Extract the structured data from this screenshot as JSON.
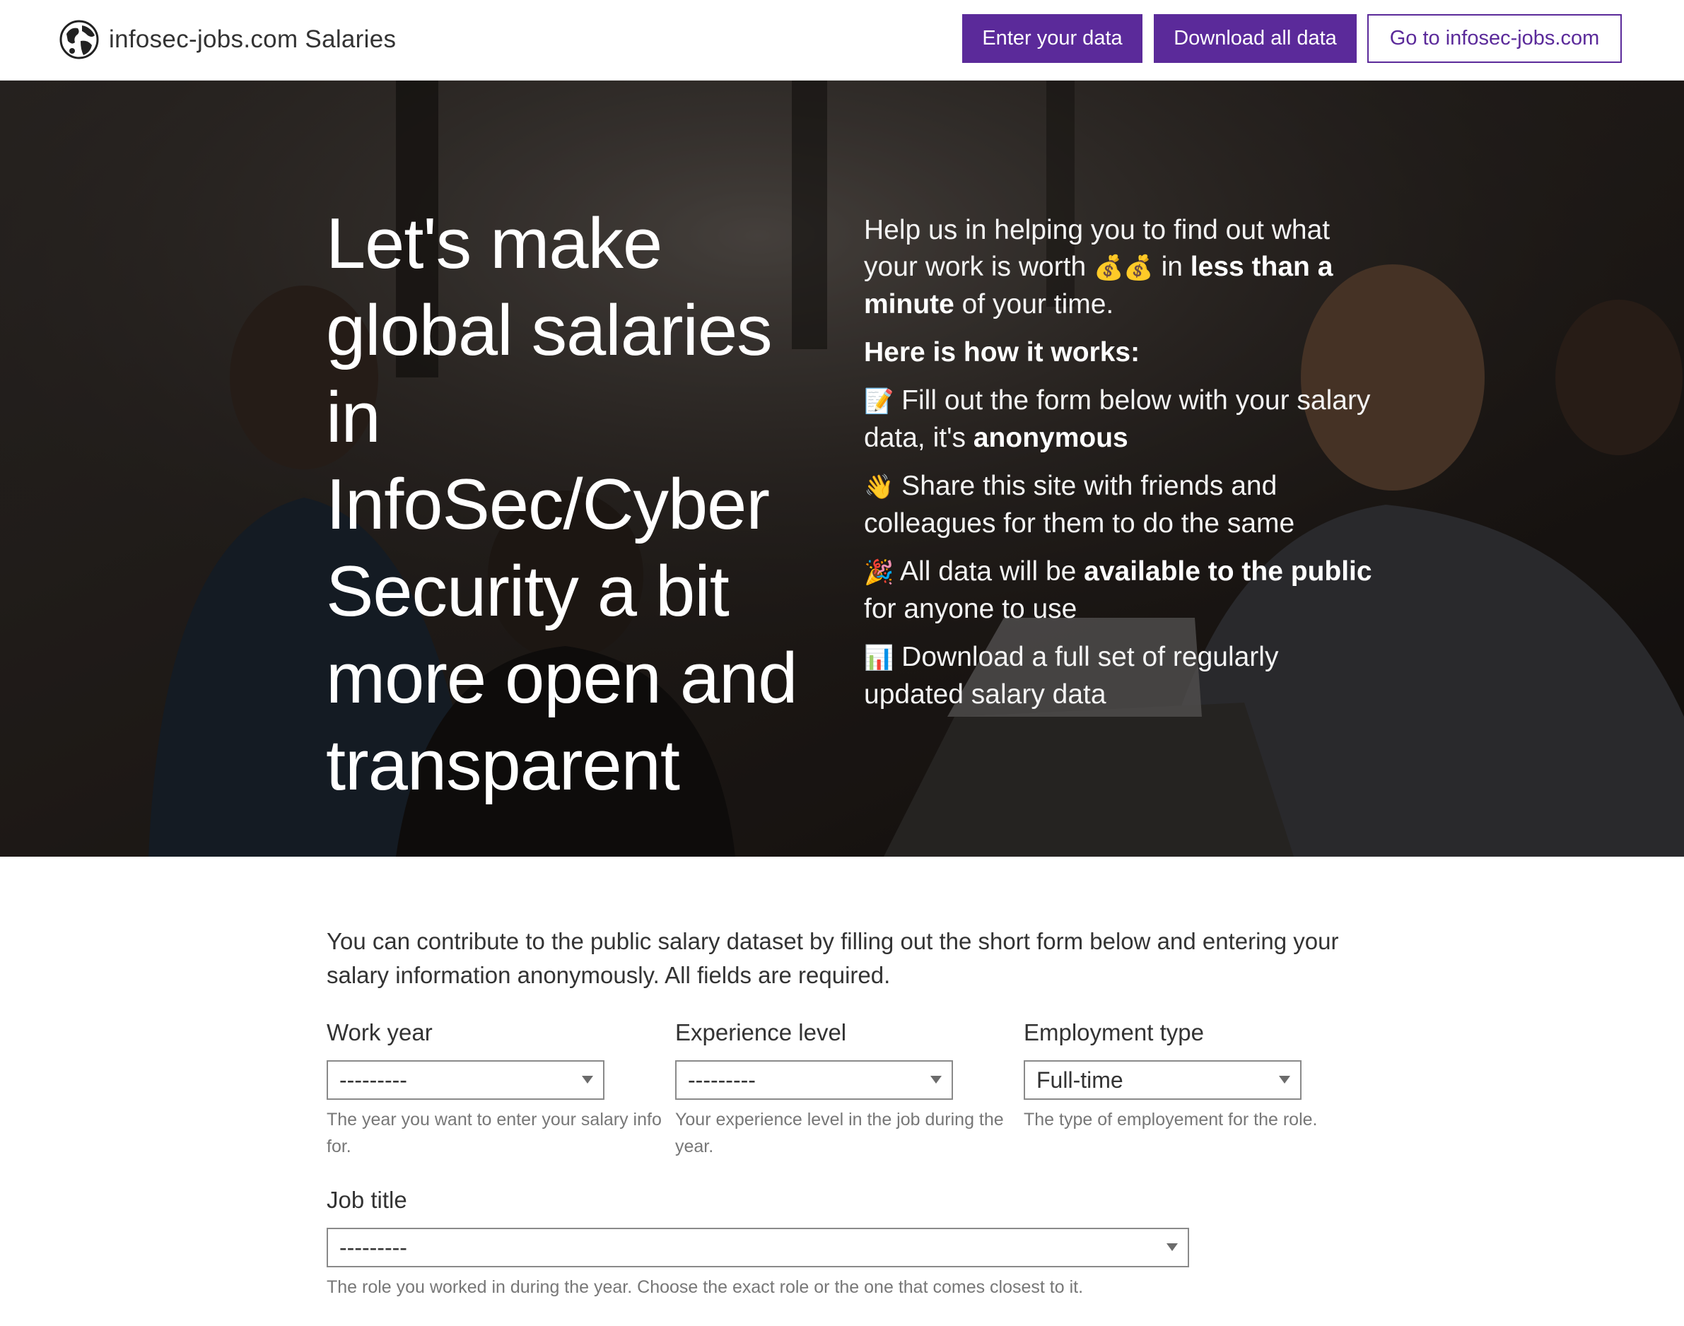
{
  "navbar": {
    "brand_text": "infosec-jobs.com Salaries",
    "logo_icon": "globe-icon",
    "buttons": {
      "enter": "Enter your data",
      "download": "Download all data",
      "goto": "Go to infosec-jobs.com"
    },
    "accent_color": "#5b2a9a"
  },
  "hero": {
    "title": "Let's make global salaries in InfoSec/Cyber Security a bit more open and transparent",
    "intro_pre": "Help us in helping you to find out what your work is worth ",
    "intro_emoji": "💰💰",
    "intro_mid": " in ",
    "intro_bold": "less than a minute",
    "intro_post": " of your time.",
    "how_heading": "Here is how it works:",
    "steps": [
      {
        "emoji": "📝",
        "text_pre": " Fill out the form below with your salary data, it's ",
        "text_bold": "anonymous",
        "text_post": ""
      },
      {
        "emoji": "👋",
        "text_pre": " Share this site with friends and colleagues for them to do the same",
        "text_bold": "",
        "text_post": ""
      },
      {
        "emoji": "🎉",
        "text_pre": " All data will be ",
        "text_bold": "available to the public",
        "text_post": " for anyone to use"
      },
      {
        "emoji": "📊",
        "text_pre": " Download a full set of regularly updated salary data",
        "text_bold": "",
        "text_post": ""
      }
    ]
  },
  "form": {
    "intro": "You can contribute to the public salary dataset by filling out the short form below and entering your salary information anonymously. All fields are required.",
    "fields": {
      "work_year": {
        "label": "Work year",
        "value": "---------",
        "help": "The year you want to enter your salary info for."
      },
      "experience_level": {
        "label": "Experience level",
        "value": "---------",
        "help": "Your experience level in the job during the year."
      },
      "employment_type": {
        "label": "Employment type",
        "value": "Full-time",
        "help": "The type of employement for the role."
      },
      "job_title": {
        "label": "Job title",
        "value": "---------",
        "help": "The role you worked in during the year. Choose the exact role or the one that comes closest to it."
      }
    }
  }
}
